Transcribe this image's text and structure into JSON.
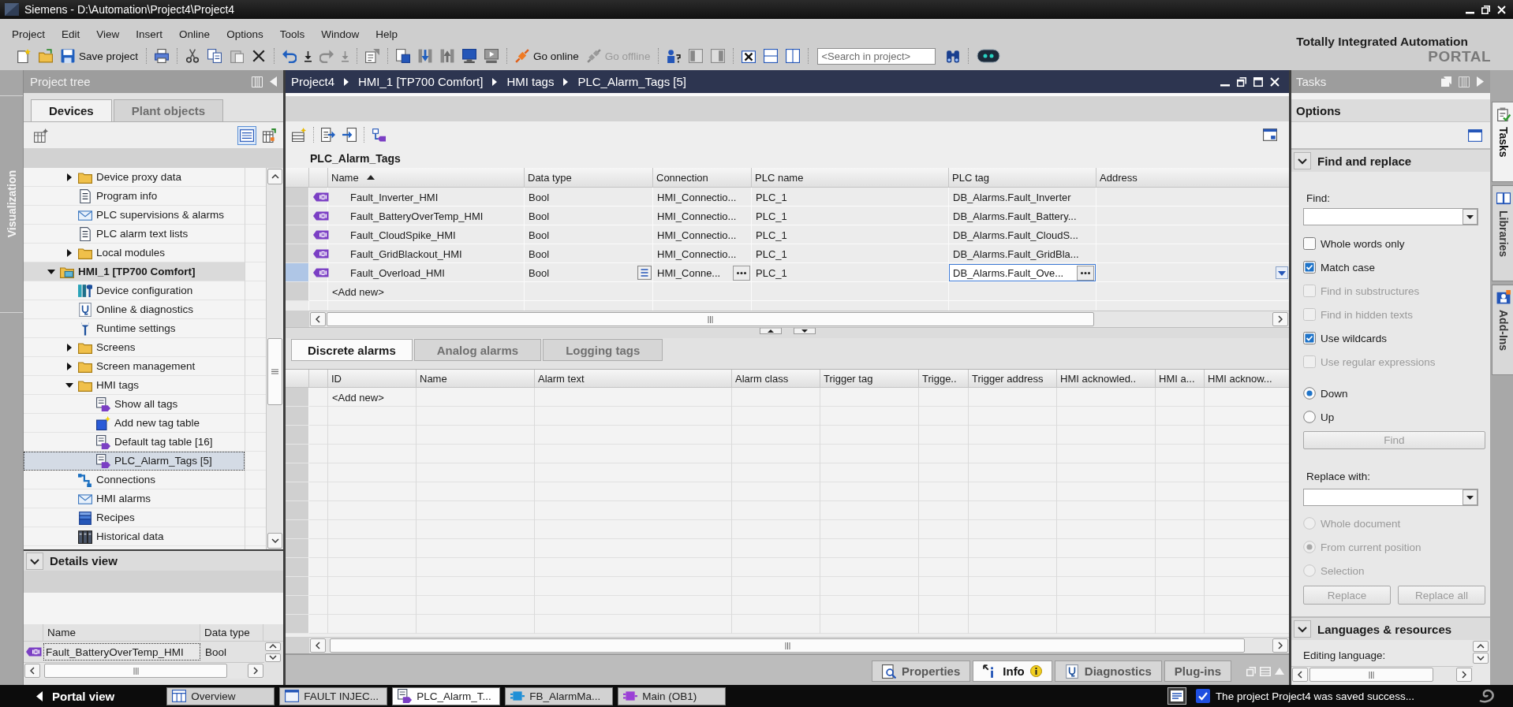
{
  "window": {
    "title": "Siemens - D:\\Automation\\Project4\\Project4"
  },
  "menu": [
    "Project",
    "Edit",
    "View",
    "Insert",
    "Online",
    "Options",
    "Tools",
    "Window",
    "Help"
  ],
  "toolbar": {
    "buttons": [
      {
        "kind": "save",
        "label": "Save project",
        "disabled": false
      },
      {
        "kind": "online",
        "label": "Go online",
        "disabled": false
      },
      {
        "kind": "offline",
        "label": "Go offline",
        "disabled": true
      }
    ],
    "search": {
      "placeholder": "<Search in project>"
    }
  },
  "branding": {
    "title": "Totally Integrated Automation",
    "subtitle": "PORTAL"
  },
  "side_strip": {
    "label": "Visualization"
  },
  "project_tree": {
    "title": "Project tree",
    "tabs": [
      {
        "label": "Devices",
        "selected": true
      },
      {
        "label": "Plant objects",
        "selected": false
      }
    ],
    "items": [
      {
        "children": [
          {
            "kind": "folder",
            "label": "Device proxy data",
            "expanded": false,
            "selected": false
          },
          {
            "kind": "document",
            "label": "Program info",
            "selected": false
          },
          {
            "kind": "alarm",
            "label": "PLC supervisions & alarms",
            "selected": false
          },
          {
            "kind": "document",
            "label": "PLC alarm text lists",
            "selected": false
          },
          {
            "kind": "folder",
            "label": "Local modules",
            "expanded": false,
            "selected": false
          }
        ]
      },
      {
        "kind": "device",
        "label": "HMI_1 [TP700 Comfort]",
        "expanded": true,
        "selected": false,
        "children": [
          {
            "kind": "configuration",
            "label": "Device configuration",
            "selected": false
          },
          {
            "kind": "diagnostics",
            "label": "Online & diagnostics",
            "selected": false
          },
          {
            "kind": "wrench",
            "label": "Runtime settings",
            "selected": false
          },
          {
            "kind": "folder",
            "label": "Screens",
            "expanded": false,
            "selected": false
          },
          {
            "kind": "folder",
            "label": "Screen management",
            "expanded": false,
            "selected": false
          },
          {
            "kind": "folder",
            "label": "HMI tags",
            "expanded": true,
            "selected": false,
            "children": [
              {
                "kind": "tags",
                "label": "Show all tags",
                "selected": false
              },
              {
                "kind": "new-table",
                "label": "Add new tag table",
                "selected": false
              },
              {
                "kind": "tags",
                "label": "Default tag table [16]",
                "selected": false
              },
              {
                "kind": "tags",
                "label": "PLC_Alarm_Tags [5]",
                "selected": true
              }
            ]
          },
          {
            "kind": "connection",
            "label": "Connections",
            "selected": false
          },
          {
            "kind": "alarm",
            "label": "HMI alarms",
            "selected": false
          },
          {
            "kind": "recipe",
            "label": "Recipes",
            "selected": false
          },
          {
            "kind": "archive",
            "label": "Historical data",
            "selected": false
          }
        ]
      }
    ]
  },
  "details_view": {
    "title": "Details view",
    "expanded": true,
    "columns": [
      "Name",
      "Data type"
    ],
    "rows": [
      {
        "name": "Fault_BatteryOverTemp_HMI",
        "data_type": "Bool",
        "selected": true
      }
    ]
  },
  "editor": {
    "breadcrumb": [
      "Project4",
      "HMI_1 [TP700 Comfort]",
      "HMI tags",
      "PLC_Alarm_Tags [5]"
    ],
    "tag_table": {
      "title": "PLC_Alarm_Tags",
      "columns": [
        {
          "label": "Name",
          "sorted": true
        },
        {
          "label": "Data type",
          "sorted": false
        },
        {
          "label": "Connection",
          "sorted": false
        },
        {
          "label": "PLC name",
          "sorted": false
        },
        {
          "label": "PLC tag",
          "sorted": false
        },
        {
          "label": "Address",
          "sorted": false
        }
      ],
      "rows": [
        {
          "name": "Fault_Inverter_HMI",
          "data_type": "Bool",
          "connection": "HMI_Connectio...",
          "plc_name": "PLC_1",
          "plc_tag": "DB_Alarms.Fault_Inverter",
          "selected": false
        },
        {
          "name": "Fault_BatteryOverTemp_HMI",
          "data_type": "Bool",
          "connection": "HMI_Connectio...",
          "plc_name": "PLC_1",
          "plc_tag": "DB_Alarms.Fault_Battery...",
          "selected": false
        },
        {
          "name": "Fault_CloudSpike_HMI",
          "data_type": "Bool",
          "connection": "HMI_Connectio...",
          "plc_name": "PLC_1",
          "plc_tag": "DB_Alarms.Fault_CloudS...",
          "selected": false
        },
        {
          "name": "Fault_GridBlackout_HMI",
          "data_type": "Bool",
          "connection": "HMI_Connectio...",
          "plc_name": "PLC_1",
          "plc_tag": "DB_Alarms.Fault_GridBla...",
          "selected": false
        },
        {
          "name": "Fault_Overload_HMI",
          "data_type": "Bool",
          "connection": "HMI_Conne...",
          "plc_name": "PLC_1",
          "plc_tag": "DB_Alarms.Fault_Ove...",
          "selected": true
        }
      ],
      "add_new": "<Add new>"
    },
    "alarm_tabs": [
      {
        "label": "Discrete alarms",
        "selected": true
      },
      {
        "label": "Analog alarms",
        "selected": false
      },
      {
        "label": "Logging tags",
        "selected": false
      }
    ],
    "alarm_table": {
      "columns": [
        "ID",
        "Name",
        "Alarm text",
        "Alarm class",
        "Trigger tag",
        "Trigge..",
        "Trigger address",
        "HMI acknowled..",
        "HMI a...",
        "HMI acknow..."
      ],
      "add_new": "<Add new>"
    }
  },
  "inspector": {
    "tabs": [
      {
        "kind": "properties",
        "label": "Properties",
        "selected": false
      },
      {
        "kind": "info",
        "label": "Info",
        "selected": true
      },
      {
        "kind": "diagnostics",
        "label": "Diagnostics",
        "selected": false
      },
      {
        "kind": "plugins",
        "label": "Plug-ins",
        "selected": false
      }
    ]
  },
  "tasks": {
    "title": "Tasks",
    "options_title": "Options",
    "find_replace": {
      "title": "Find and replace",
      "expanded": true,
      "find_label": "Find:",
      "options": [
        {
          "label": "Whole words only",
          "checked": false,
          "disabled": false
        },
        {
          "label": "Match case",
          "checked": true,
          "disabled": false
        },
        {
          "label": "Find in substructures",
          "checked": false,
          "disabled": true
        },
        {
          "label": "Find in hidden texts",
          "checked": false,
          "disabled": true
        },
        {
          "label": "Use wildcards",
          "checked": true,
          "disabled": false
        },
        {
          "label": "Use regular expressions",
          "checked": false,
          "disabled": true
        }
      ],
      "direction": [
        {
          "label": "Down",
          "selected": true,
          "disabled": false
        },
        {
          "label": "Up",
          "selected": false,
          "disabled": false
        }
      ],
      "find_button": {
        "label": "Find",
        "disabled": true
      },
      "replace_label": "Replace with:",
      "scope": [
        {
          "label": "Whole document",
          "selected": false,
          "disabled": true
        },
        {
          "label": "From current position",
          "selected": true,
          "disabled": true
        },
        {
          "label": "Selection",
          "selected": false,
          "disabled": true
        }
      ],
      "replace_buttons": [
        {
          "label": "Replace",
          "disabled": true
        },
        {
          "label": "Replace all",
          "disabled": true
        }
      ]
    },
    "languages": {
      "title": "Languages & resources",
      "expanded": true,
      "editing_language_label": "Editing language:"
    }
  },
  "side_tabs": [
    {
      "kind": "tasks",
      "label": "Tasks",
      "selected": true
    },
    {
      "kind": "libraries",
      "label": "Libraries",
      "selected": false
    },
    {
      "kind": "add-ins",
      "label": "Add-Ins",
      "selected": false
    }
  ],
  "taskbar": {
    "portal_view": "Portal view",
    "tabs": [
      {
        "kind": "overview",
        "label": "Overview",
        "selected": false
      },
      {
        "kind": "screen",
        "label": "FAULT INJEC...",
        "selected": false
      },
      {
        "kind": "tag-table",
        "label": "PLC_Alarm_T...",
        "selected": true
      },
      {
        "kind": "function-block",
        "label": "FB_AlarmMa...",
        "selected": false
      },
      {
        "kind": "organization-block",
        "label": "Main (OB1)",
        "selected": false
      }
    ],
    "status": "The project Project4 was saved success..."
  }
}
